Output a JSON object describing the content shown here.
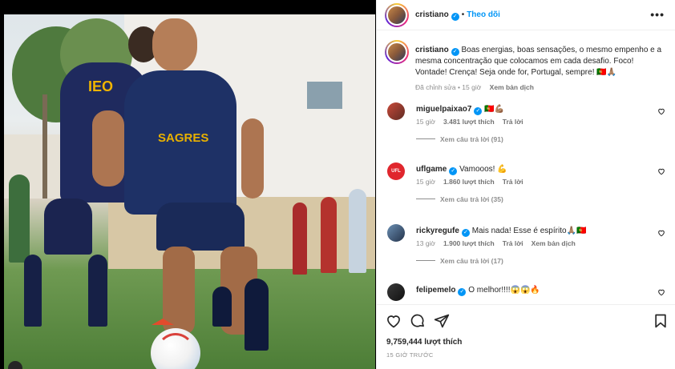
{
  "post": {
    "author": "cristiano",
    "follow_label": "Theo dõi",
    "more_label": "•••",
    "caption_text": "Boas energias, boas sensações, o mesmo empenho e a mesma concentração que colocamos em cada desafio. Foco! Vontade! Crença! Seja onde for, Portugal, sempre! 🇵🇹🙏🏽",
    "edited_label": "Đã chỉnh sửa",
    "time_ago": "15 giờ",
    "see_translation": "Xem bản dịch",
    "likes": "9,759,444 lượt thích",
    "posted_ago": "15 GIỜ TRƯỚC"
  },
  "photo": {
    "shirt_text": "SAGRES",
    "back_shirt_text": "IEO"
  },
  "comments": [
    {
      "user": "miguelpaixao7",
      "text": "🇵🇹💪🏽",
      "time": "15 giờ",
      "likes": "3.481 lượt thích",
      "reply": "Trả lời",
      "translate": "",
      "view_replies": "Xem câu trả lời (91)"
    },
    {
      "user": "uflgame",
      "text": "Vamooos! 💪",
      "time": "15 giờ",
      "likes": "1.860 lượt thích",
      "reply": "Trả lời",
      "translate": "",
      "view_replies": "Xem câu trả lời (35)"
    },
    {
      "user": "rickyregufe",
      "text": "Mais nada! Esse é espírito🙏🏽🇵🇹",
      "time": "13 giờ",
      "likes": "1.900 lượt thích",
      "reply": "Trả lời",
      "translate": "Xem bản dịch",
      "view_replies": "Xem câu trả lời (17)"
    },
    {
      "user": "felipemelo",
      "text": "O melhor!!!!😱😱🔥",
      "time": "",
      "likes": "",
      "reply": "",
      "translate": "",
      "view_replies": ""
    }
  ],
  "icons": {
    "like": "heart-icon",
    "comment": "comment-icon",
    "share": "share-icon",
    "save": "bookmark-icon"
  },
  "colors": {
    "accent": "#0095f6",
    "muted": "#8e8e8e",
    "text": "#262626"
  }
}
